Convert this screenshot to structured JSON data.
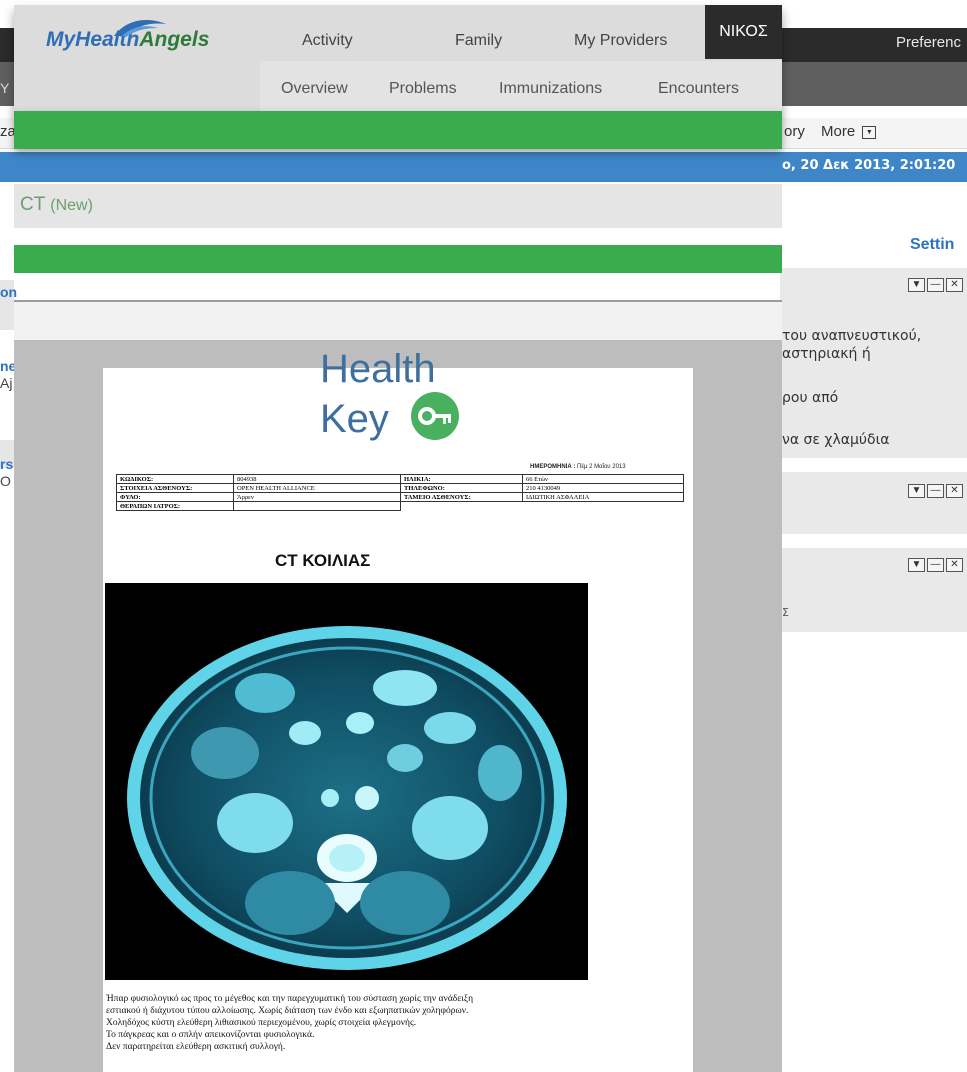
{
  "background_app": {
    "topbar": {
      "preferences_label": "Preferenc"
    },
    "subbar": {
      "left_fragment": "Y"
    },
    "menu": {
      "left_fragment": "za",
      "history_fragment": "ory",
      "more_label": "More",
      "more_icon": "chevron-down-box-icon"
    },
    "date_text": "ο, 20 Δεκ 2013, 2:01:20",
    "settings_label": "Settin",
    "left_fragments": [
      "on",
      "ne",
      "Aj",
      "rs",
      "O"
    ],
    "panels": [
      {
        "lines": [
          "του αναπνευστικού,",
          "αστηριακή ή",
          "",
          "ρου από",
          "",
          "να σε χλαμύδια"
        ]
      },
      {
        "lines": []
      },
      {
        "lines": [
          "Σ"
        ]
      }
    ]
  },
  "overlay": {
    "logo": {
      "part1": "MyHealth",
      "part2": "Angels"
    },
    "main_nav": [
      "Activity",
      "Family",
      "My Providers"
    ],
    "user_label": "ΝΙΚΟΣ",
    "sub_nav": [
      "Overview",
      "Problems",
      "Immunizations",
      "Encounters"
    ],
    "record_title": "CT",
    "record_status": "(New)"
  },
  "document": {
    "brand_line1": "Health",
    "brand_line2": "Key",
    "date_label": "ΗΜΕΡΟΜΗΝΙΑ :",
    "date_value": "Πέμ 2 Μαΐου 2013",
    "patient_rows": [
      [
        "ΚΩΔΙΚΟΣ:",
        "804938",
        "ΗΛΙΚΙΑ:",
        "66 Ετών"
      ],
      [
        "ΣΤΟΙΧΕΙΑ ΑΣΘΕΝΟΥΣ:",
        "OPEN HEALTH ALLIANCE",
        "ΤΗΛΕΦΩΝΟ:",
        "210 4130049"
      ],
      [
        "ΦΥΛΟ:",
        "Άρρεν",
        "ΤΑΜΕΙΟ ΑΣΘΕΝΟΥΣ:",
        "ΙΔΙΩΤΙΚΗ ΑΣΦΑΛΕΙΑ"
      ],
      [
        "ΘΕΡΑΠΩΝ ΙΑΤΡΟΣ:",
        "",
        "",
        ""
      ]
    ],
    "exam_title": "CT ΚΟΙΛΙΑΣ",
    "report_lines": [
      "Ήπαρ φυσιολογικό ως προς το μέγεθος και την παρεγχυματική του σύσταση χωρίς την ανάδειξη",
      "εστιακού ή διάχυτου τύπου αλλοίωσης. Χωρίς διάταση των ένδο και εξωηπατικών χοληφόρων.",
      "Χοληδόχος κύστη ελεύθερη λιθιασικού περιεχομένου, χωρίς στοιχεία φλεγμονής.",
      "Το πάγκρεας και ο σπλήν απεικονίζονται φυσιολογικά.",
      "Δεν παρατηρείται ελεύθερη ασκιτική συλλογή."
    ]
  },
  "colors": {
    "brand_blue": "#2f6db5",
    "brand_green": "#3aac4d",
    "dark_bar": "#2b2b2b",
    "date_bar": "#3f86c8",
    "healthkey_blue": "#3e6f9e",
    "healthkey_green": "#48b05f"
  }
}
